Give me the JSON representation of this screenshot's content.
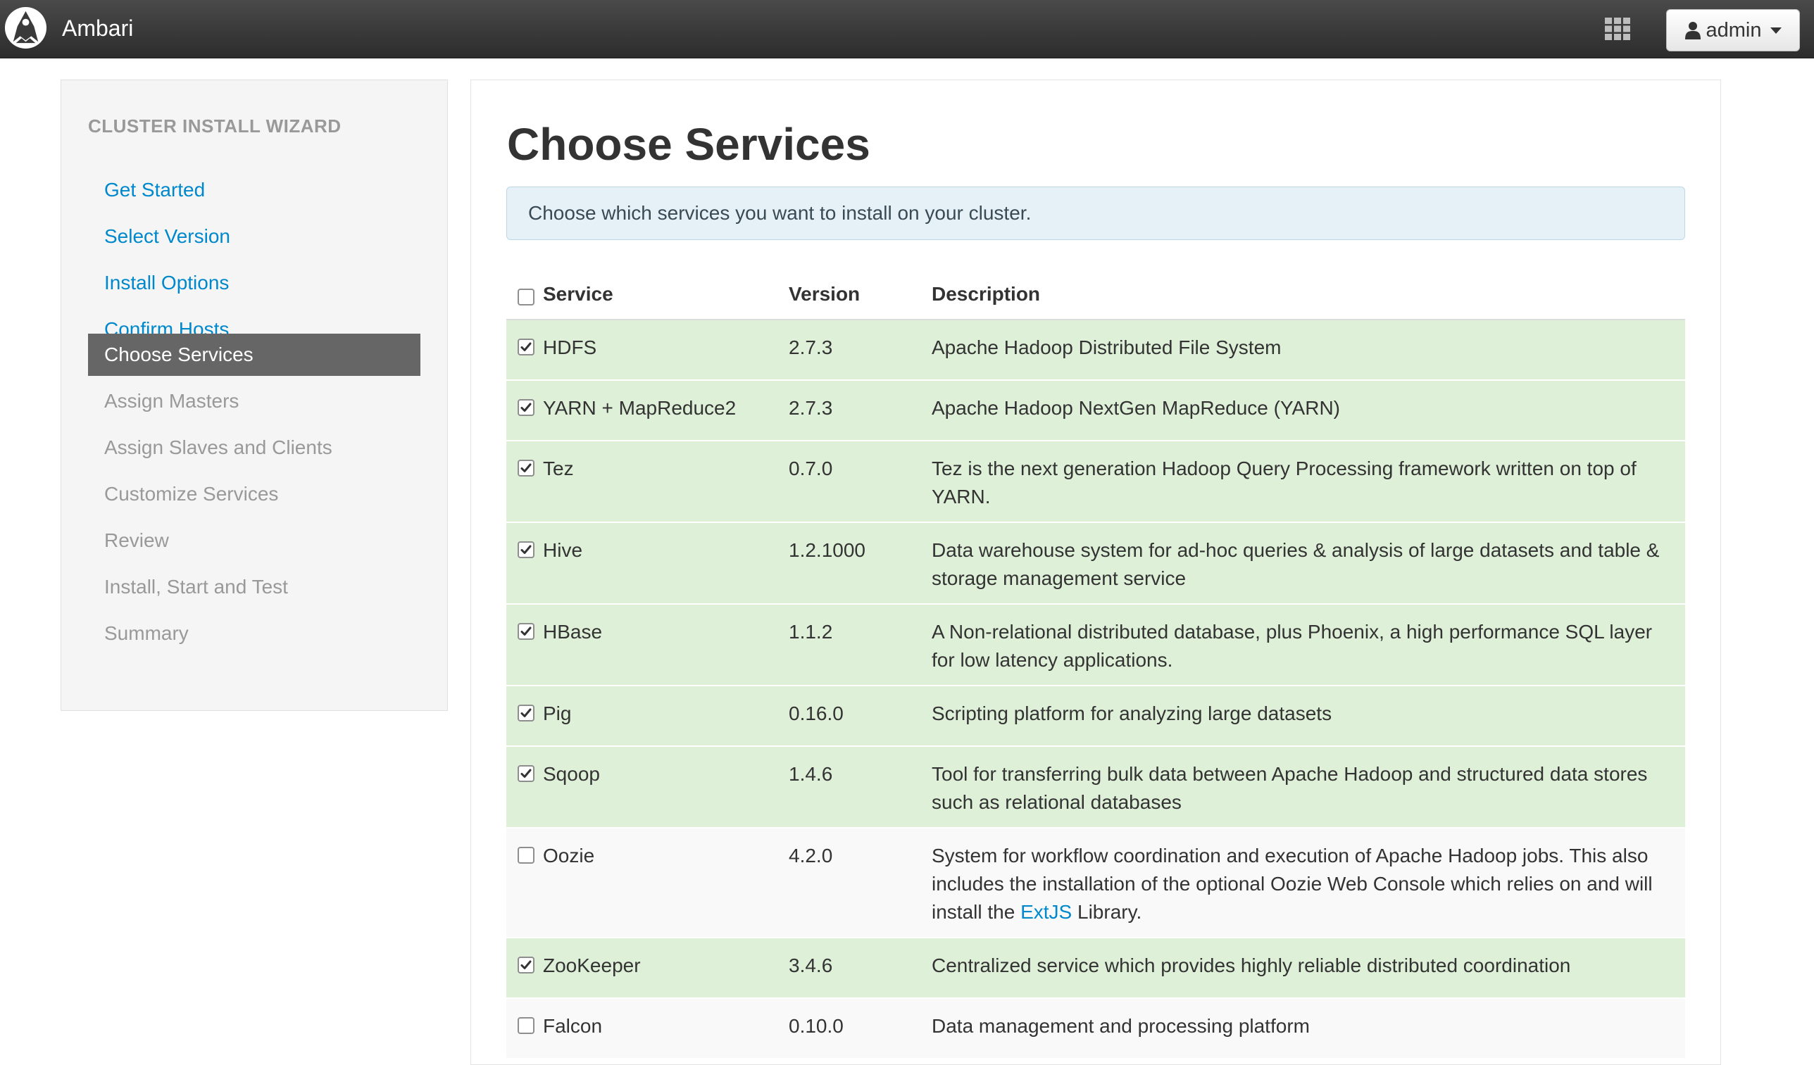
{
  "navbar": {
    "brand": "Ambari",
    "apps_icon": "grid-icon",
    "user_label": "admin",
    "user_icon": "user-icon"
  },
  "sidebar": {
    "header": "CLUSTER INSTALL WIZARD",
    "steps": [
      {
        "label": "Get Started",
        "state": "done"
      },
      {
        "label": "Select Version",
        "state": "done"
      },
      {
        "label": "Install Options",
        "state": "done"
      },
      {
        "label": "Confirm Hosts",
        "state": "done"
      },
      {
        "label": "Choose Services",
        "state": "active"
      },
      {
        "label": "Assign Masters",
        "state": "todo"
      },
      {
        "label": "Assign Slaves and Clients",
        "state": "todo"
      },
      {
        "label": "Customize Services",
        "state": "todo"
      },
      {
        "label": "Review",
        "state": "todo"
      },
      {
        "label": "Install, Start and Test",
        "state": "todo"
      },
      {
        "label": "Summary",
        "state": "todo"
      }
    ]
  },
  "main": {
    "title": "Choose Services",
    "alert": "Choose which services you want to install on your cluster.",
    "table": {
      "select_all_checked": false,
      "headers": {
        "service": "Service",
        "version": "Version",
        "description": "Description"
      },
      "rows": [
        {
          "service": "HDFS",
          "version": "2.7.3",
          "checked": true,
          "description": "Apache Hadoop Distributed File System"
        },
        {
          "service": "YARN + MapReduce2",
          "version": "2.7.3",
          "checked": true,
          "description": "Apache Hadoop NextGen MapReduce (YARN)"
        },
        {
          "service": "Tez",
          "version": "0.7.0",
          "checked": true,
          "description": "Tez is the next generation Hadoop Query Processing framework written on top of YARN."
        },
        {
          "service": "Hive",
          "version": "1.2.1000",
          "checked": true,
          "description": "Data warehouse system for ad-hoc queries & analysis of large datasets and table & storage management service"
        },
        {
          "service": "HBase",
          "version": "1.1.2",
          "checked": true,
          "description": "A Non-relational distributed database, plus Phoenix, a high performance SQL layer for low latency applications."
        },
        {
          "service": "Pig",
          "version": "0.16.0",
          "checked": true,
          "description": "Scripting platform for analyzing large datasets"
        },
        {
          "service": "Sqoop",
          "version": "1.4.6",
          "checked": true,
          "description": "Tool for transferring bulk data between Apache Hadoop and structured data stores such as relational databases"
        },
        {
          "service": "Oozie",
          "version": "4.2.0",
          "checked": false,
          "description": "System for workflow coordination and execution of Apache Hadoop jobs. This also includes the installation of the optional Oozie Web Console which relies on and will install the",
          "description_link": "ExtJS",
          "description_suffix": "Library."
        },
        {
          "service": "ZooKeeper",
          "version": "3.4.6",
          "checked": true,
          "description": "Centralized service which provides highly reliable distributed coordination"
        },
        {
          "service": "Falcon",
          "version": "0.10.0",
          "checked": false,
          "description": "Data management and processing platform"
        }
      ]
    }
  }
}
